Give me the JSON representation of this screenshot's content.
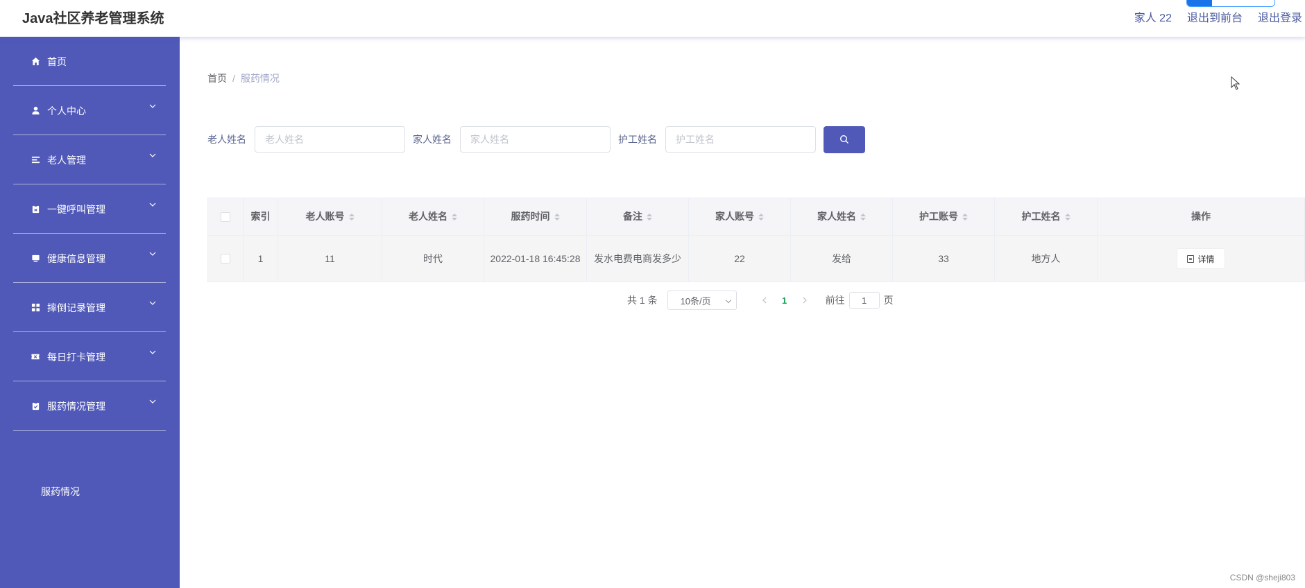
{
  "header": {
    "title": "Java社区养老管理系统",
    "user": "家人 22",
    "to_frontend": "退出到前台",
    "logout": "退出登录"
  },
  "sidebar": {
    "items": [
      {
        "label": "首页",
        "icon": "home-icon"
      },
      {
        "label": "个人中心",
        "icon": "user-icon"
      },
      {
        "label": "老人管理",
        "icon": "list-icon"
      },
      {
        "label": "一键呼叫管理",
        "icon": "clipboard-icon"
      },
      {
        "label": "健康信息管理",
        "icon": "monitor-icon"
      },
      {
        "label": "摔倒记录管理",
        "icon": "grid-icon"
      },
      {
        "label": "每日打卡管理",
        "icon": "ticket-icon"
      },
      {
        "label": "服药情况管理",
        "icon": "clipboard-check-icon"
      }
    ],
    "subitem": "服药情况"
  },
  "breadcrumb": {
    "home": "首页",
    "sep": "/",
    "current": "服药情况"
  },
  "search": {
    "elder_label": "老人姓名",
    "elder_placeholder": "老人姓名",
    "family_label": "家人姓名",
    "family_placeholder": "家人姓名",
    "nurse_label": "护工姓名",
    "nurse_placeholder": "护工姓名"
  },
  "table": {
    "columns": [
      "索引",
      "老人账号",
      "老人姓名",
      "服药时间",
      "备注",
      "家人账号",
      "家人姓名",
      "护工账号",
      "护工姓名",
      "操作"
    ],
    "rows": [
      [
        "1",
        "11",
        "时代",
        "2022-01-18 16:45:28",
        "发水电费电商发多少",
        "22",
        "发给",
        "33",
        "地方人"
      ]
    ],
    "detail_label": "详情"
  },
  "pagination": {
    "total": "共 1 条",
    "page_size": "10条/页",
    "current": "1",
    "goto_prefix": "前往",
    "goto_value": "1",
    "goto_suffix": "页"
  },
  "watermark": "CSDN @sheji803",
  "colors": {
    "sidebar": "#5059b8",
    "accent": "#5059b8",
    "active_page": "#18a058"
  }
}
